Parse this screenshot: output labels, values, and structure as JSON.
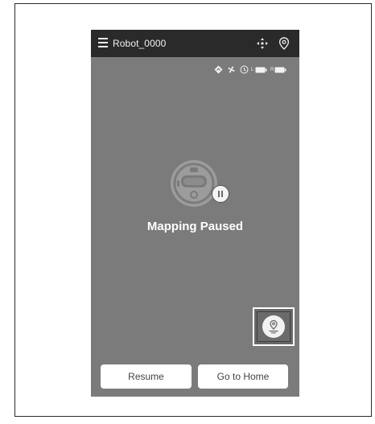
{
  "header": {
    "title": "Robot_0000",
    "menu_icon": "hamburger-menu-icon",
    "right_icons": [
      "move-arrows-icon",
      "location-pin-icon"
    ]
  },
  "status_bar": {
    "icons": [
      "diamond-direction-icon",
      "fan-icon",
      "robot-status-icon",
      "battery-l-icon",
      "battery-r-icon"
    ],
    "battery_left_label": "L",
    "battery_right_label": "R"
  },
  "main": {
    "status": "Mapping Paused",
    "robot_icon": "robot-vacuum-icon",
    "badge_icon": "pause-icon"
  },
  "map_button": {
    "icon": "map-pin-icon"
  },
  "actions": {
    "resume_label": "Resume",
    "home_label": "Go to Home"
  },
  "colors": {
    "screen_background": "#7b7b7b",
    "header_background": "#2a2a2a",
    "button_background": "#ffffff",
    "text_light": "#ffffff"
  }
}
